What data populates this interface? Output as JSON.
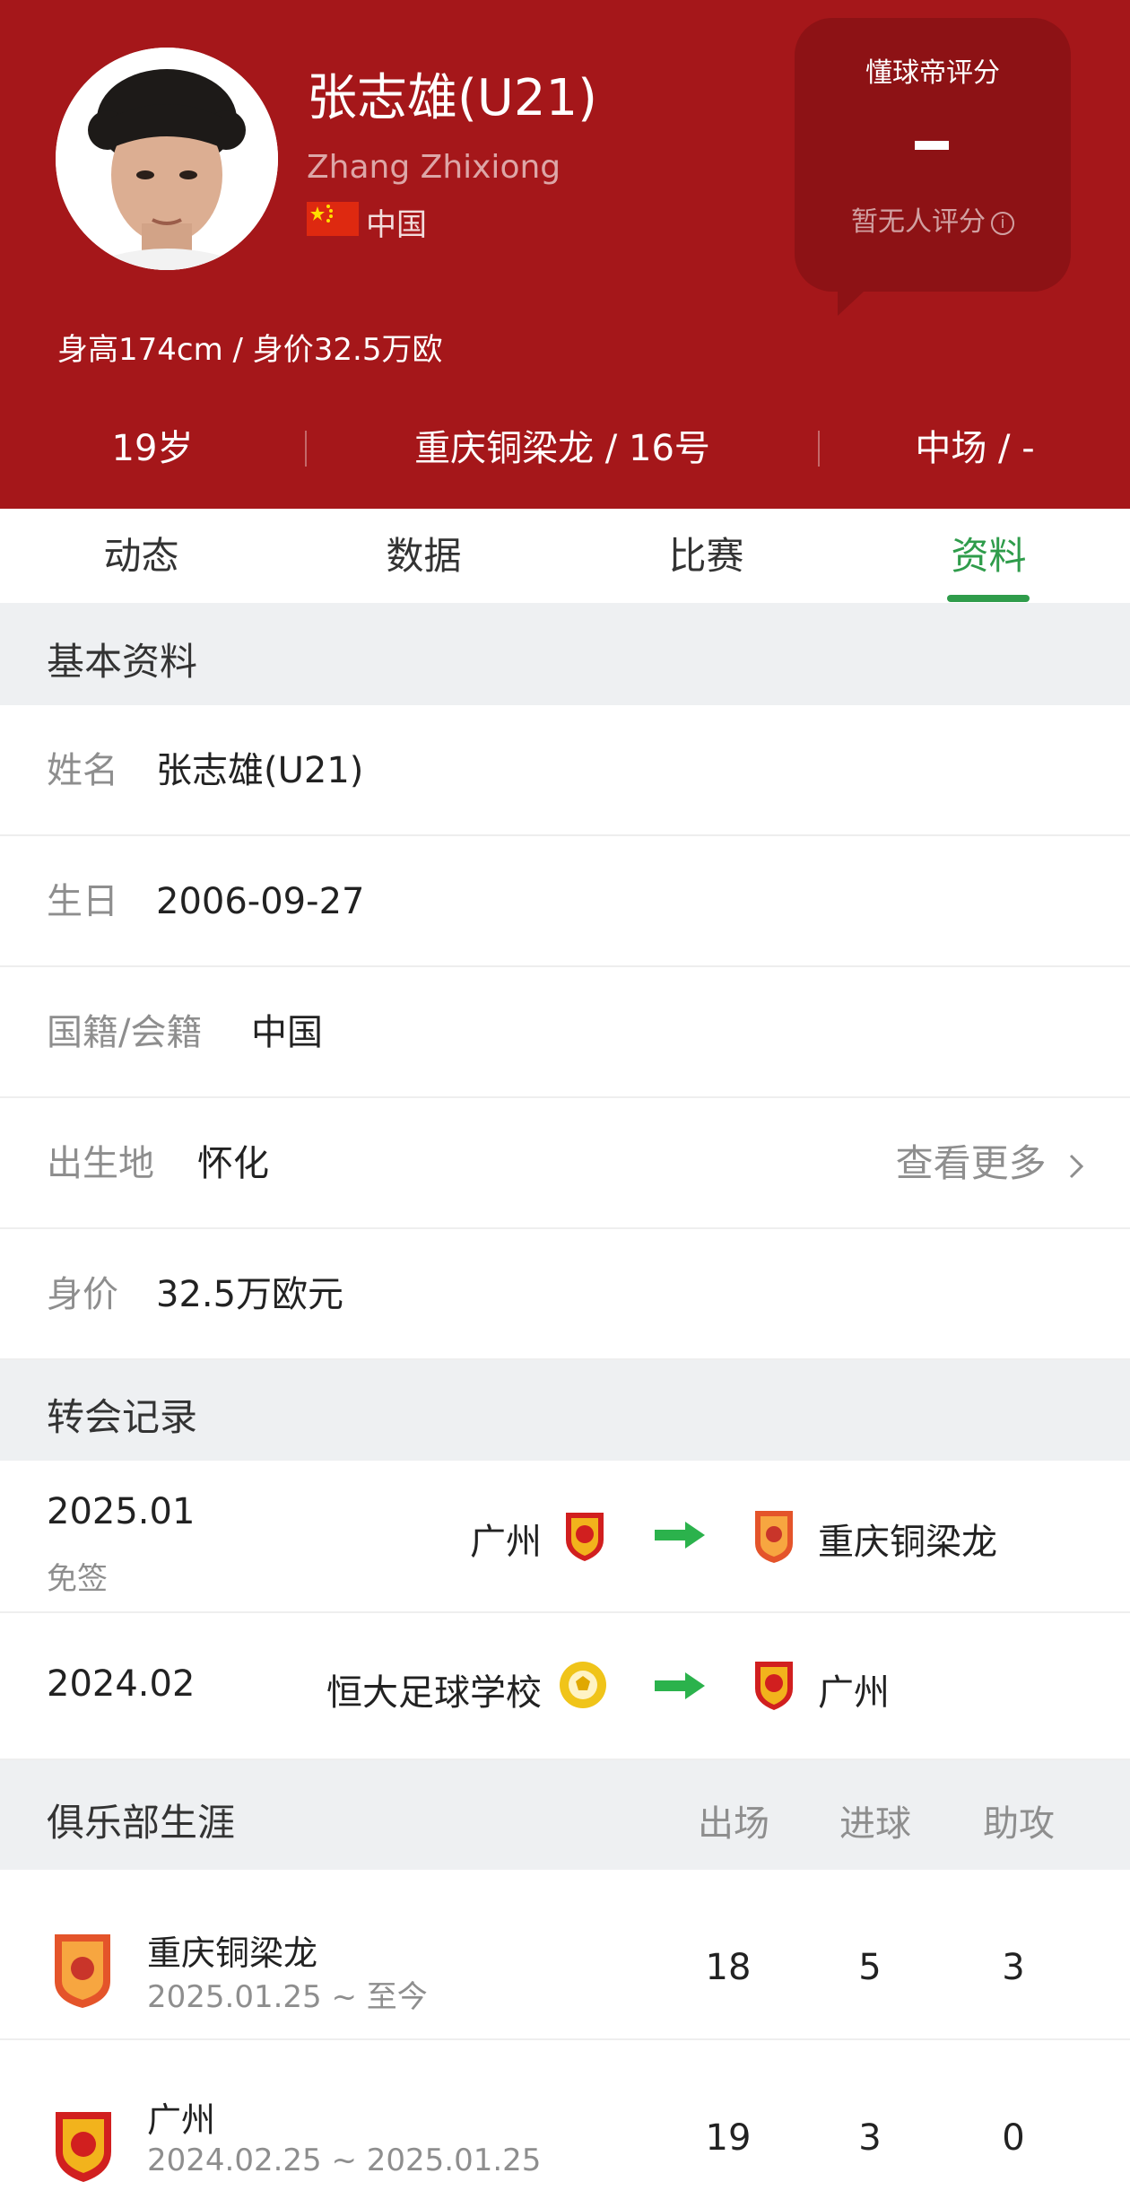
{
  "player": {
    "name_cn": "张志雄(U21)",
    "name_en": "Zhang Zhixiong",
    "country": "中国",
    "height_value_text": "身高174cm / 身价32.5万欧"
  },
  "rating": {
    "title": "懂球帝评分",
    "score": "-",
    "note": "暂无人评分"
  },
  "stats": {
    "age": "19岁",
    "club_number": "重庆铜梁龙 / 16号",
    "position": "中场 / -"
  },
  "tabs": [
    {
      "label": "动态",
      "active": false
    },
    {
      "label": "数据",
      "active": false
    },
    {
      "label": "比赛",
      "active": false
    },
    {
      "label": "资料",
      "active": true
    }
  ],
  "basic_info": {
    "title": "基本资料",
    "rows": [
      {
        "label": "姓名",
        "value": "张志雄(U21)"
      },
      {
        "label": "生日",
        "value": "2006-09-27"
      },
      {
        "label": "国籍/会籍",
        "value": "中国"
      },
      {
        "label": "出生地",
        "value": "怀化",
        "more": "查看更多"
      },
      {
        "label": "身价",
        "value": "32.5万欧元"
      }
    ]
  },
  "transfers": {
    "title": "转会记录",
    "items": [
      {
        "date": "2025.01",
        "type": "免签",
        "from": "广州",
        "to": "重庆铜梁龙"
      },
      {
        "date": "2024.02",
        "type": "",
        "from": "恒大足球学校",
        "to": "广州"
      }
    ]
  },
  "career": {
    "title": "俱乐部生涯",
    "columns": [
      "出场",
      "进球",
      "助攻"
    ],
    "rows": [
      {
        "club": "重庆铜梁龙",
        "period": "2025.01.25 ~ 至今",
        "apps": "18",
        "goals": "5",
        "assists": "3"
      },
      {
        "club": "广州",
        "period": "2024.02.25 ~ 2025.01.25",
        "apps": "19",
        "goals": "3",
        "assists": "0"
      }
    ]
  },
  "icons": {
    "flag": "china-flag-icon",
    "info": "info-icon",
    "chevron": "chevron-right-icon",
    "arrow": "transfer-arrow-icon",
    "crest_guangzhou": "guangzhou-crest-icon",
    "crest_chongqing": "chongqing-crest-icon",
    "crest_academy": "evergrande-school-crest-icon"
  },
  "colors": {
    "header_bg": "#a5171a",
    "rating_bg": "#8d1215",
    "accent_green": "#2f9c4b",
    "section_bg": "#eef0f2"
  }
}
